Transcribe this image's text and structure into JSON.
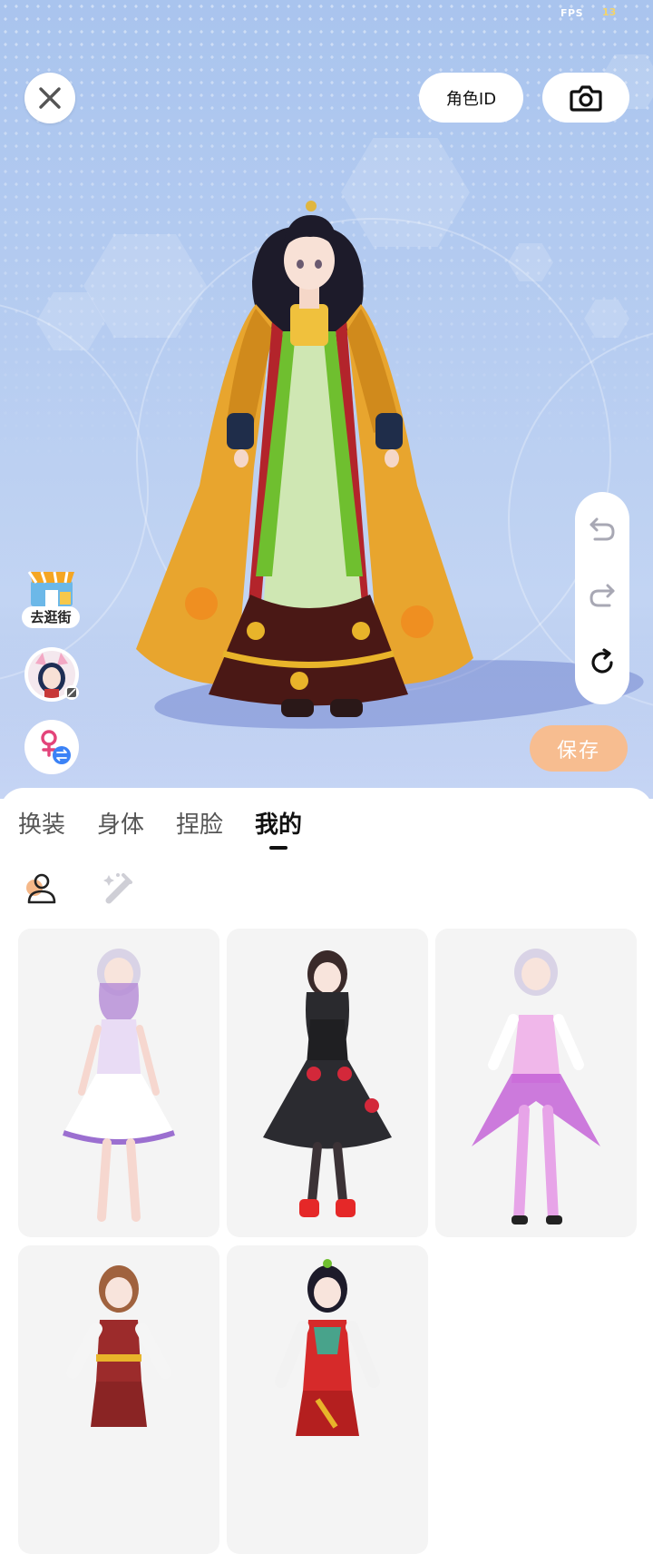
{
  "status": {
    "fps_label": "FPS",
    "fps_value": "13"
  },
  "header": {
    "role_id_label": "角色ID"
  },
  "left_actions": {
    "shop_label": "去逛街"
  },
  "actions": {
    "save_label": "保存"
  },
  "tabs": [
    {
      "label": "换装",
      "active": false
    },
    {
      "label": "身体",
      "active": false
    },
    {
      "label": "捏脸",
      "active": false
    },
    {
      "label": "我的",
      "active": true
    }
  ],
  "icons": [
    "close-icon",
    "camera-icon",
    "undo-icon",
    "redo-icon",
    "reset-icon",
    "gender-switch-icon",
    "person-icon",
    "magic-wand-icon"
  ],
  "colors": {
    "accent_save": "#f7bd90",
    "scene_bg": "#b7cdf1",
    "gender_pink": "#e3447a",
    "swap_blue": "#3b82f6"
  }
}
